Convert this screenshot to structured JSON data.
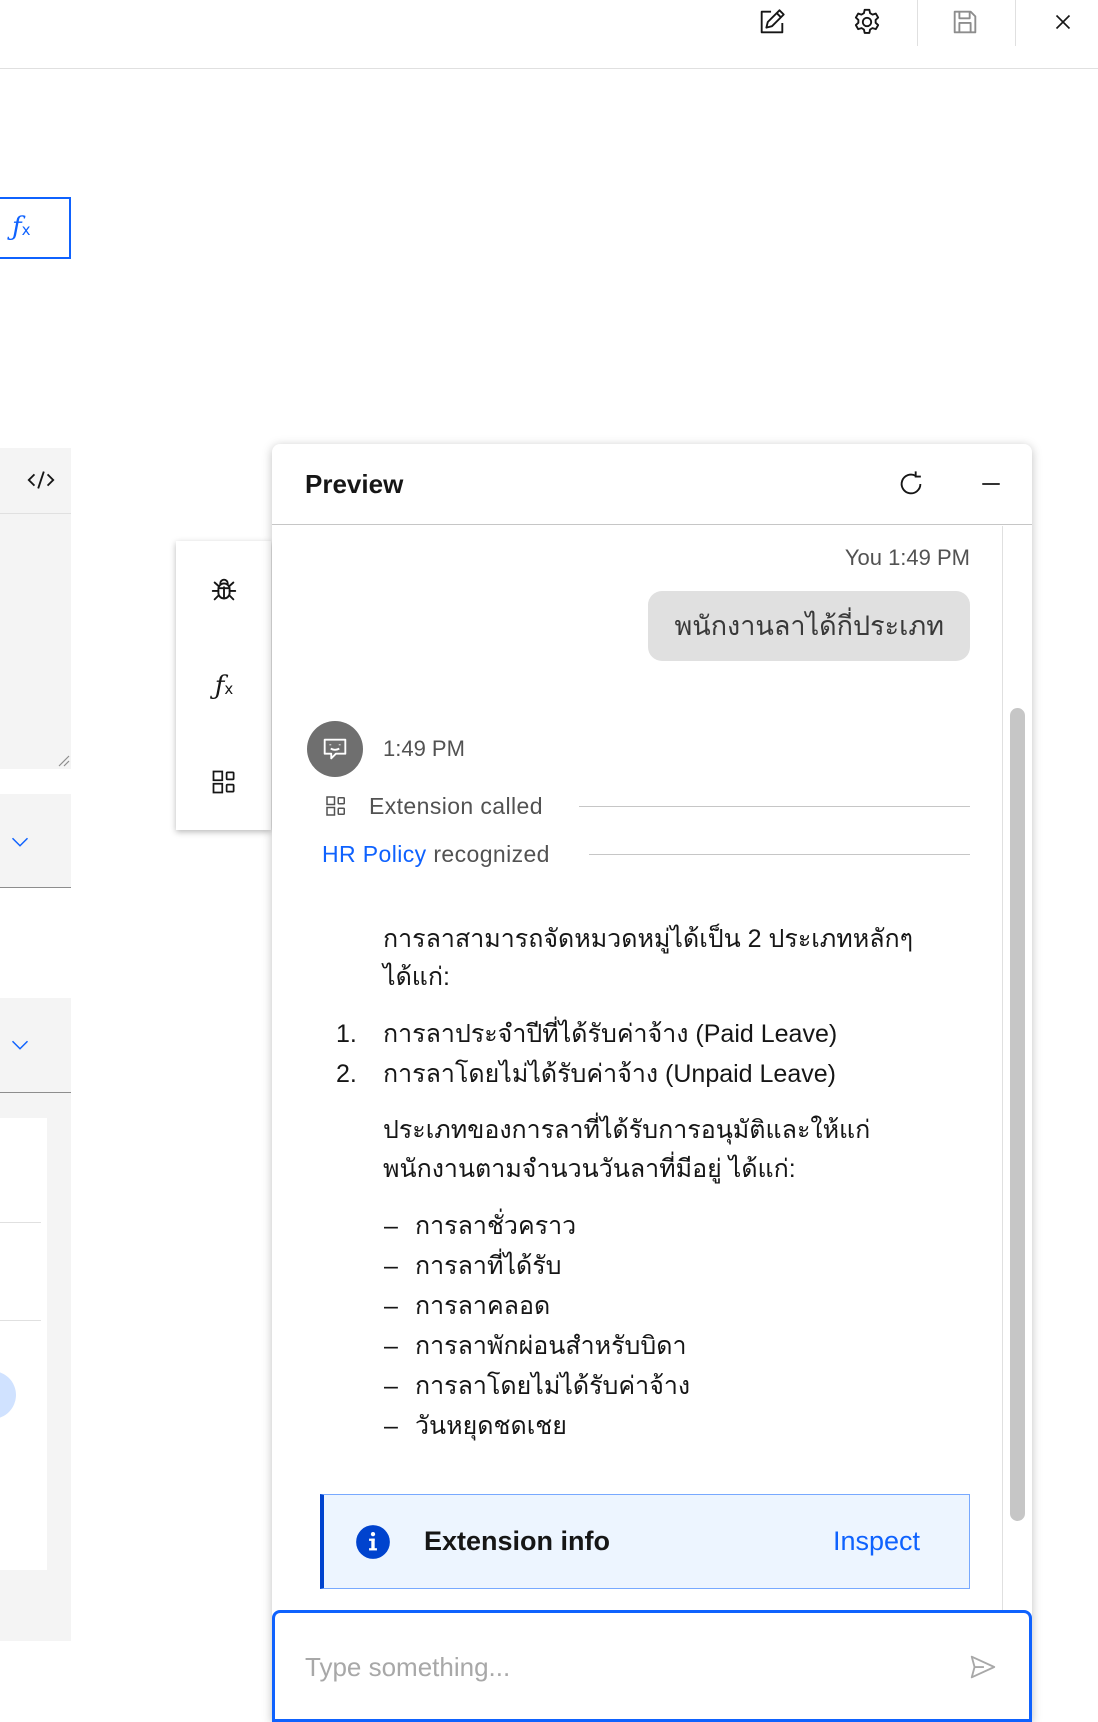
{
  "colors": {
    "accent": "#0f62fe",
    "info": "#0043ce",
    "bubble": "#e0e0e0",
    "panel_bg": "#f4f4f4"
  },
  "toolbar": {
    "icons": [
      "edit-icon",
      "settings-icon",
      "save-icon",
      "close-icon"
    ]
  },
  "left_panel": {
    "formula_icon": "fx-icon",
    "code_icon": "code-icon",
    "dropdown_icon": "chevron-down-icon"
  },
  "side_toolbar": {
    "icons": [
      "debug-icon",
      "fx-icon",
      "extension-icon"
    ]
  },
  "preview": {
    "title": "Preview",
    "header_icons": [
      "refresh-icon",
      "minimize-icon"
    ],
    "user_message": {
      "sender": "You",
      "time": "1:49 PM",
      "text": "พนักงานลาได้กี่ประเภท"
    },
    "bot_message": {
      "avatar_icon": "bot-chat-icon",
      "time": "1:49 PM",
      "extension_called": "Extension called",
      "recognized": {
        "link": "HR Policy",
        "text": "recognized"
      },
      "intro_lines": [
        "การลาสามารถจัดหมวดหมู่ได้เป็น 2 ประเภทหลักๆ",
        "ได้แก่:"
      ],
      "ordered": [
        {
          "marker": "1.",
          "text": "การลาประจำปีที่ได้รับค่าจ้าง (Paid Leave)"
        },
        {
          "marker": "2.",
          "text": "การลาโดยไม่ได้รับค่าจ้าง (Unpaid Leave)"
        }
      ],
      "para_lines": [
        "ประเภทของการลาที่ได้รับการอนุมัติและให้แก่",
        "พนักงานตามจำนวนวันลาที่มีอยู่ ได้แก่:"
      ],
      "bullets": [
        {
          "marker": "–",
          "text": "การลาชั่วคราว"
        },
        {
          "marker": "–",
          "text": "การลาที่ได้รับ"
        },
        {
          "marker": "–",
          "text": "การลาคลอด"
        },
        {
          "marker": "–",
          "text": "การลาพักผ่อนสำหรับบิดา"
        },
        {
          "marker": "–",
          "text": "การลาโดยไม่ได้รับค่าจ้าง"
        },
        {
          "marker": "–",
          "text": "วันหยุดชดเชย"
        }
      ]
    },
    "extension_info": {
      "label": "Extension info",
      "action": "Inspect",
      "icon": "info-icon"
    },
    "input": {
      "placeholder": "Type something...",
      "send_icon": "send-icon"
    }
  }
}
